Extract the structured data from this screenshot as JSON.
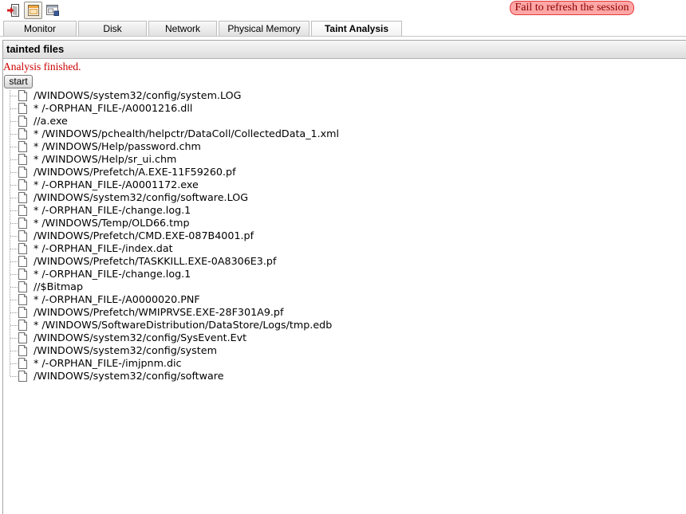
{
  "toolbar": {
    "buttons": [
      {
        "icon": "exit-icon",
        "pressed": false
      },
      {
        "icon": "window-icon",
        "pressed": true
      },
      {
        "icon": "window-properties-icon",
        "pressed": false
      }
    ],
    "error_message": "Fail to refresh the session"
  },
  "tabs": [
    {
      "label": "Monitor",
      "selected": false
    },
    {
      "label": "Disk",
      "selected": false
    },
    {
      "label": "Network",
      "selected": false
    },
    {
      "label": "Physical Memory",
      "selected": false
    },
    {
      "label": "Taint Analysis",
      "selected": true
    }
  ],
  "panel": {
    "title": "tainted files",
    "status": "Analysis finished.",
    "start_button": "start",
    "file_icon": "file-icon",
    "files": [
      "/WINDOWS/system32/config/system.LOG",
      "* /-ORPHAN_FILE-/A0001216.dll",
      "//a.exe",
      "* /WINDOWS/pchealth/helpctr/DataColl/CollectedData_1.xml",
      "* /WINDOWS/Help/password.chm",
      "* /WINDOWS/Help/sr_ui.chm",
      "/WINDOWS/Prefetch/A.EXE-11F59260.pf",
      "* /-ORPHAN_FILE-/A0001172.exe",
      "/WINDOWS/system32/config/software.LOG",
      "* /-ORPHAN_FILE-/change.log.1",
      "* /WINDOWS/Temp/OLD66.tmp",
      "/WINDOWS/Prefetch/CMD.EXE-087B4001.pf",
      "* /-ORPHAN_FILE-/index.dat",
      "/WINDOWS/Prefetch/TASKKILL.EXE-0A8306E3.pf",
      "* /-ORPHAN_FILE-/change.log.1",
      "//$Bitmap",
      "* /-ORPHAN_FILE-/A0000020.PNF",
      "/WINDOWS/Prefetch/WMIPRVSE.EXE-28F301A9.pf",
      "* /WINDOWS/SoftwareDistribution/DataStore/Logs/tmp.edb",
      "/WINDOWS/system32/config/SysEvent.Evt",
      "/WINDOWS/system32/config/system",
      "* /-ORPHAN_FILE-/imjpnm.dic",
      "/WINDOWS/system32/config/software"
    ]
  },
  "colors": {
    "status_text": "#cc0000",
    "badge_background": "#ffa6a6",
    "badge_border": "#e03c3c",
    "badge_text": "#8b0000"
  }
}
